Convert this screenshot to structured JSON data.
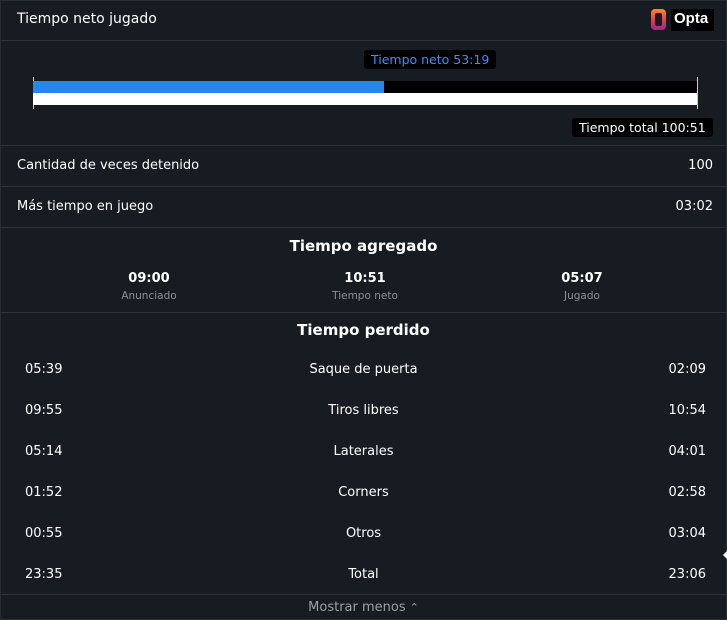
{
  "header": {
    "title": "Tiempo neto jugado",
    "logo_text": "Opta"
  },
  "net_time": {
    "net_label": "Tiempo neto 53:19",
    "total_label": "Tiempo total 100:51",
    "net_fraction": 0.5287,
    "colors": {
      "fill": "#2a86ef",
      "track": "#000000"
    }
  },
  "stats": [
    {
      "label": "Cantidad de veces detenido",
      "value": "100"
    },
    {
      "label": "Más tiempo en juego",
      "value": "03:02"
    }
  ],
  "added_time": {
    "title": "Tiempo agregado",
    "items": [
      {
        "value": "09:00",
        "caption": "Anunciado"
      },
      {
        "value": "10:51",
        "caption": "Tiempo neto"
      },
      {
        "value": "05:07",
        "caption": "Jugado"
      }
    ]
  },
  "lost_time": {
    "title": "Tiempo perdido",
    "rows": [
      {
        "left": "05:39",
        "label": "Saque de puerta",
        "right": "02:09"
      },
      {
        "left": "09:55",
        "label": "Tiros libres",
        "right": "10:54"
      },
      {
        "left": "05:14",
        "label": "Laterales",
        "right": "04:01"
      },
      {
        "left": "01:52",
        "label": "Corners",
        "right": "02:58"
      },
      {
        "left": "00:55",
        "label": "Otros",
        "right": "03:04"
      },
      {
        "left": "23:35",
        "label": "Total",
        "right": "23:06"
      }
    ]
  },
  "footer": {
    "show_less_label": "Mostrar menos",
    "icon": "chevron-up-icon"
  }
}
